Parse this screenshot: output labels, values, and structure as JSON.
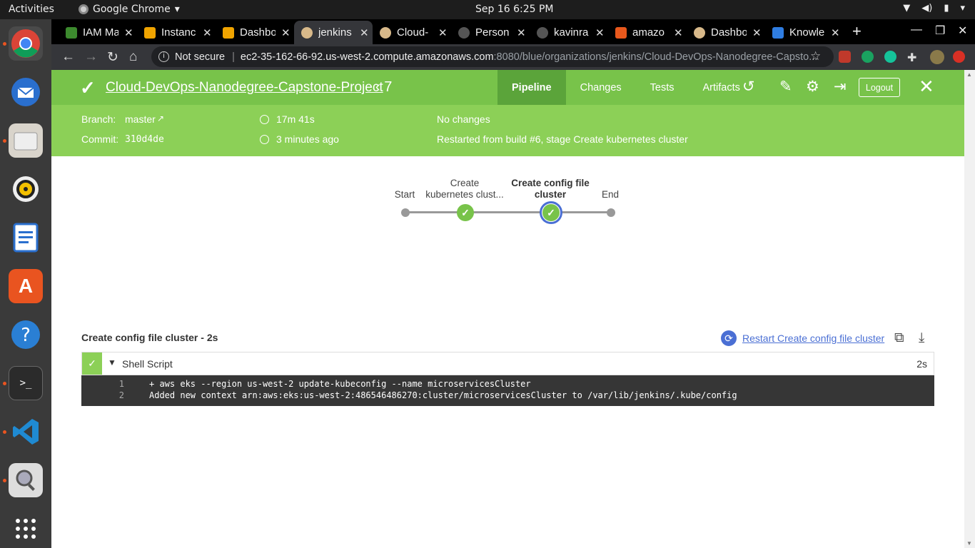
{
  "system": {
    "activities": "Activities",
    "app_name": "Google Chrome",
    "clock": "Sep 16   6:25 PM"
  },
  "browser": {
    "tabs": [
      {
        "label": "IAM Ma",
        "color": "#3c8a2e"
      },
      {
        "label": "Instanc",
        "color": "#f0a400"
      },
      {
        "label": "Dashbo",
        "color": "#f0a400"
      },
      {
        "label": "jenkins",
        "color": "#d8b98a"
      },
      {
        "label": "Cloud-",
        "color": "#d8b98a"
      },
      {
        "label": "Person",
        "color": "#555555"
      },
      {
        "label": "kavinra",
        "color": "#555555"
      },
      {
        "label": "amazo",
        "color": "#e8581c"
      },
      {
        "label": "Dashbo",
        "color": "#d8b98a"
      },
      {
        "label": "Knowle",
        "color": "#2f7de1"
      }
    ],
    "not_secure": "Not secure",
    "url_host": "ec2-35-162-66-92.us-west-2.compute.amazonaws.com",
    "url_path": ":8080/blue/organizations/jenkins/Cloud-DevOps-Nanodegree-Capsto..."
  },
  "run": {
    "title": "Cloud-DevOps-Nanodegree-Capstone-Project",
    "run_number": "7",
    "tabs": [
      "Pipeline",
      "Changes",
      "Tests",
      "Artifacts"
    ],
    "logout": "Logout",
    "branch_label": "Branch:",
    "branch_value": "master",
    "commit_label": "Commit:",
    "commit_value": "310d4de",
    "duration": "17m 41s",
    "time_ago": "3 minutes ago",
    "changes": "No changes",
    "cause": "Restarted from build #6, stage Create kubernetes cluster"
  },
  "pipeline": {
    "stages": [
      {
        "line1": "Start",
        "line2": ""
      },
      {
        "line1": "Create",
        "line2": "kubernetes clust..."
      },
      {
        "line1": "Create config file",
        "line2": "cluster"
      },
      {
        "line1": "End",
        "line2": ""
      }
    ]
  },
  "step": {
    "title": "Create config file cluster - 2s",
    "restart_label": "Restart Create config file cluster",
    "name": "Shell Script",
    "duration": "2s",
    "log": [
      {
        "n": "1",
        "text": "+ aws eks --region us-west-2 update-kubeconfig --name microservicesCluster"
      },
      {
        "n": "2",
        "text": "Added new context arn:aws:eks:us-west-2:486546486270:cluster/microservicesCluster to /var/lib/jenkins/.kube/config"
      }
    ]
  }
}
